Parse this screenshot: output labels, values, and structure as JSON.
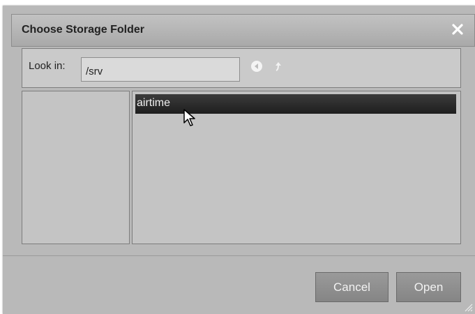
{
  "dialog": {
    "title": "Choose Storage Folder",
    "close_icon": "close-icon"
  },
  "lookin": {
    "label": "Look in:",
    "path_value": "/srv",
    "back_icon": "back-arrow-icon",
    "up_icon": "up-arrow-icon"
  },
  "files": {
    "items": [
      {
        "name": "airtime",
        "selected": true
      }
    ]
  },
  "buttons": {
    "cancel_label": "Cancel",
    "open_label": "Open"
  },
  "colors": {
    "dialog_bg": "#b9b9b9",
    "titlebar": "#b0b0b0",
    "selection": "#2a2a2a",
    "button": "#8f8f8f"
  }
}
